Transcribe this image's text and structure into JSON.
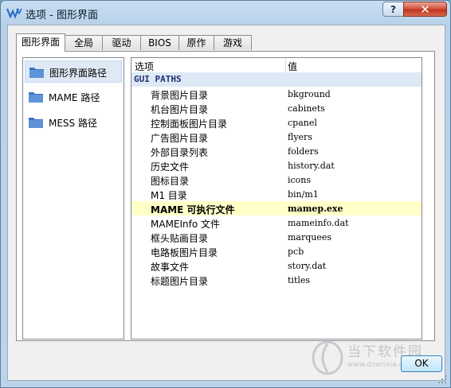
{
  "window": {
    "title": "选项 - 图形界面",
    "help_label": "?",
    "close_label": "✕"
  },
  "tabs": [
    {
      "label": "图形界面",
      "active": true
    },
    {
      "label": "全局",
      "active": false
    },
    {
      "label": "驱动",
      "active": false
    },
    {
      "label": "BIOS",
      "active": false
    },
    {
      "label": "原作",
      "active": false
    },
    {
      "label": "游戏",
      "active": false
    }
  ],
  "left_list": [
    {
      "label": "图形界面路径",
      "icon": "folder-icon",
      "selected": true
    },
    {
      "label": "MAME 路径",
      "icon": "folder-icon",
      "selected": false
    },
    {
      "label": "MESS 路径",
      "icon": "folder-icon",
      "selected": false
    }
  ],
  "grid": {
    "col_option": "选项",
    "col_value": "值",
    "group": "GUI PATHS",
    "rows": [
      {
        "name": "背景图片目录",
        "value": "bkground"
      },
      {
        "name": "机台图片目录",
        "value": "cabinets"
      },
      {
        "name": "控制面板图片目录",
        "value": "cpanel"
      },
      {
        "name": "广告图片目录",
        "value": "flyers"
      },
      {
        "name": "外部目录列表",
        "value": "folders"
      },
      {
        "name": "历史文件",
        "value": "history.dat"
      },
      {
        "name": "图标目录",
        "value": "icons"
      },
      {
        "name": "M1 目录",
        "value": "bin/m1"
      },
      {
        "name": "MAME 可执行文件",
        "value": "mamep.exe",
        "highlight": true
      },
      {
        "name": "MAMEInfo 文件",
        "value": "mameinfo.dat"
      },
      {
        "name": "框头贴画目录",
        "value": "marquees"
      },
      {
        "name": "电路板图片目录",
        "value": "pcb"
      },
      {
        "name": "故事文件",
        "value": "story.dat"
      },
      {
        "name": "标题图片目录",
        "value": "titles"
      }
    ]
  },
  "ok_label": "OK",
  "watermark": {
    "text": "当下软件园",
    "url": "www.downxia.com"
  },
  "colors": {
    "selection_bg": "#dfe9f5",
    "highlight_row": "#ffffc8",
    "group_row_bg": "#dde9f5",
    "folder_blue": "#4a7fc8"
  }
}
